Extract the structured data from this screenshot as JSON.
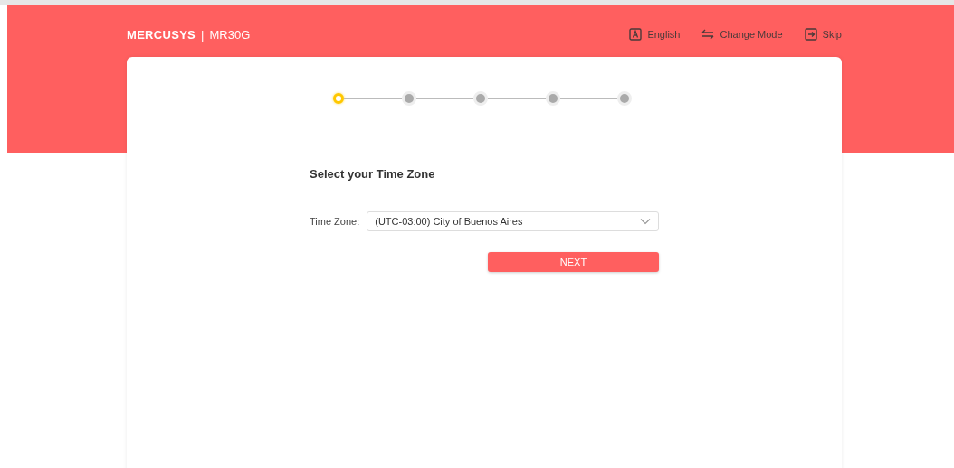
{
  "header": {
    "brand": "MERCUSYS",
    "separator": "|",
    "model": "MR30G",
    "actions": [
      {
        "kind": "language",
        "label": "English"
      },
      {
        "kind": "mode",
        "label": "Change Mode"
      },
      {
        "kind": "skip",
        "label": "Skip"
      }
    ]
  },
  "steps": [
    {
      "selected": true
    },
    {
      "selected": false
    },
    {
      "selected": false
    },
    {
      "selected": false
    },
    {
      "selected": false
    }
  ],
  "form": {
    "title": "Select your Time Zone",
    "field_label": "Time Zone:",
    "value": "(UTC-03:00) City of Buenos Aires",
    "button": "NEXT"
  }
}
